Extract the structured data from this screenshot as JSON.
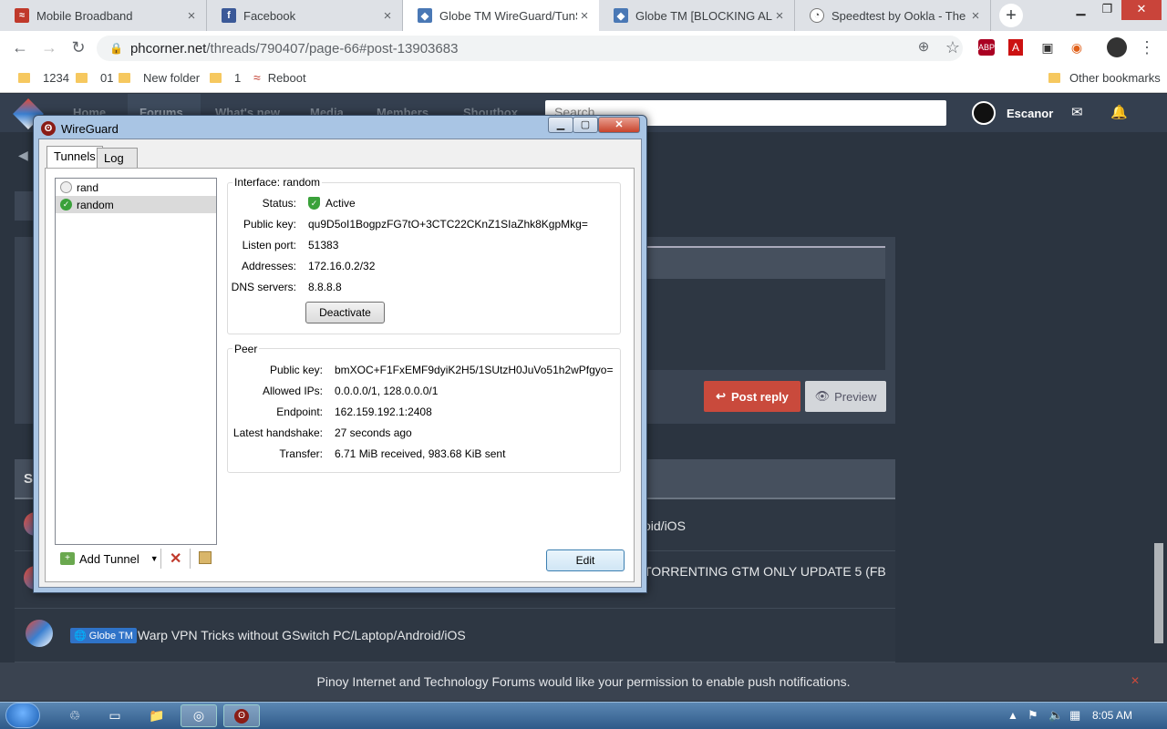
{
  "browser": {
    "tabs": [
      {
        "title": "Mobile Broadband",
        "icon": "router-icon",
        "color": "#c0392b"
      },
      {
        "title": "Facebook",
        "icon": "facebook-icon",
        "color": "#3b5998"
      },
      {
        "title": "Globe TM WireGuard/TunSa",
        "icon": "phcorner-icon",
        "color": "#4a78b5"
      },
      {
        "title": "Globe TM [BLOCKING ALERT",
        "icon": "phcorner-icon",
        "color": "#4a78b5"
      },
      {
        "title": "Speedtest by Ookla - The Gl",
        "icon": "speedtest-icon",
        "color": "#555555"
      }
    ],
    "url_host": "phcorner.net",
    "url_path": "/threads/790407/page-66#post-13903683",
    "bookmarks": [
      "1234",
      "01",
      "New folder",
      "1",
      "Reboot"
    ],
    "other_bookmarks": "Other bookmarks"
  },
  "site": {
    "nav": [
      "Home",
      "Forums",
      "What's new",
      "Media",
      "Members",
      "Shoutbox"
    ],
    "search_placeholder": "Search...",
    "username": "Escanor",
    "post_reply": "Post reply",
    "preview": "Preview",
    "section_initial": "S",
    "threads": [
      {
        "text": "oid/iOS"
      },
      {
        "text": "TORRENTING GTM ONLY UPDATE 5 (FB"
      },
      {
        "badge": "Globe TM",
        "text": "Warp VPN Tricks without GSwitch PC/Laptop/Android/iOS"
      }
    ],
    "notification": "Pinoy Internet and Technology Forums would like your permission to enable push notifications."
  },
  "wireguard": {
    "title": "WireGuard",
    "tabs": [
      "Tunnels",
      "Log"
    ],
    "tunnels": [
      {
        "name": "rand",
        "active": false
      },
      {
        "name": "random",
        "active": true
      }
    ],
    "interface": {
      "group_title": "Interface: random",
      "status_label": "Status:",
      "status": "Active",
      "public_key_label": "Public key:",
      "public_key": "qu9D5oI1BogpzFG7tO+3CTC22CKnZ1SIaZhk8KgpMkg=",
      "listen_port_label": "Listen port:",
      "listen_port": "51383",
      "addresses_label": "Addresses:",
      "addresses": "172.16.0.2/32",
      "dns_label": "DNS servers:",
      "dns": "8.8.8.8",
      "deactivate": "Deactivate"
    },
    "peer": {
      "group_title": "Peer",
      "public_key_label": "Public key:",
      "public_key": "bmXOC+F1FxEMF9dyiK2H5/1SUtzH0JuVo51h2wPfgyo=",
      "allowed_ips_label": "Allowed IPs:",
      "allowed_ips": "0.0.0.0/1, 128.0.0.0/1",
      "endpoint_label": "Endpoint:",
      "endpoint": "162.159.192.1:2408",
      "handshake_label": "Latest handshake:",
      "handshake": "27 seconds ago",
      "transfer_label": "Transfer:",
      "transfer": "6.71 MiB received, 983.68 KiB sent"
    },
    "add_tunnel": "Add Tunnel",
    "edit": "Edit"
  },
  "taskbar": {
    "time": "8:05 AM"
  },
  "colors": {
    "accent": "#c94a3c",
    "active_green": "#3aa13a"
  }
}
